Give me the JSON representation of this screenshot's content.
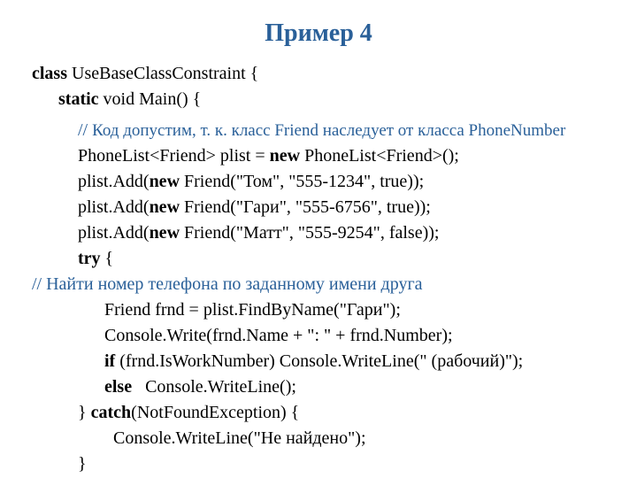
{
  "title": "Пример 4",
  "l1a": "class",
  "l1b": " UseBaseClassConstraint {",
  "l2a": "static",
  "l2b": " void Main() {",
  "l3a": "// ",
  "l3b": "Код допустим, т. к. класс Friend наследует от класса PhoneNumber",
  "l4a": "PhoneList<Friend> plist = ",
  "l4b": "new",
  "l4c": " PhoneList<Friend>();",
  "l5a": "plist.Add(",
  "l5b": "new",
  "l5c": " Friend(\"Том\", \"555-1234\", true));",
  "l6a": "plist.Add(",
  "l6b": "new",
  "l6c": " Friend(\"Гари\", \"555-6756\", true));",
  "l7a": "plist.Add(",
  "l7b": "new",
  "l7c": " Friend(\"Матт\", \"555-9254\", false));",
  "l8a": "try",
  "l8b": " {",
  "l9": "// Найти номер телефона по заданному имени друга",
  "l10": "Friend frnd = plist.FindByName(\"Гари\");",
  "l11": "Console.Write(frnd.Name + \": \" + frnd.Number);",
  "l12a": "if",
  "l12b": " (frnd.IsWorkNumber) Console.WriteLine(\" (рабочий)\");",
  "l13a": "else",
  "l13b": "   Console.WriteLine();",
  "l14a": "} ",
  "l14b": "catch",
  "l14c": "(NotFoundException) {",
  "l15": "Console.WriteLine(\"Не найдено\");",
  "l16": "}"
}
